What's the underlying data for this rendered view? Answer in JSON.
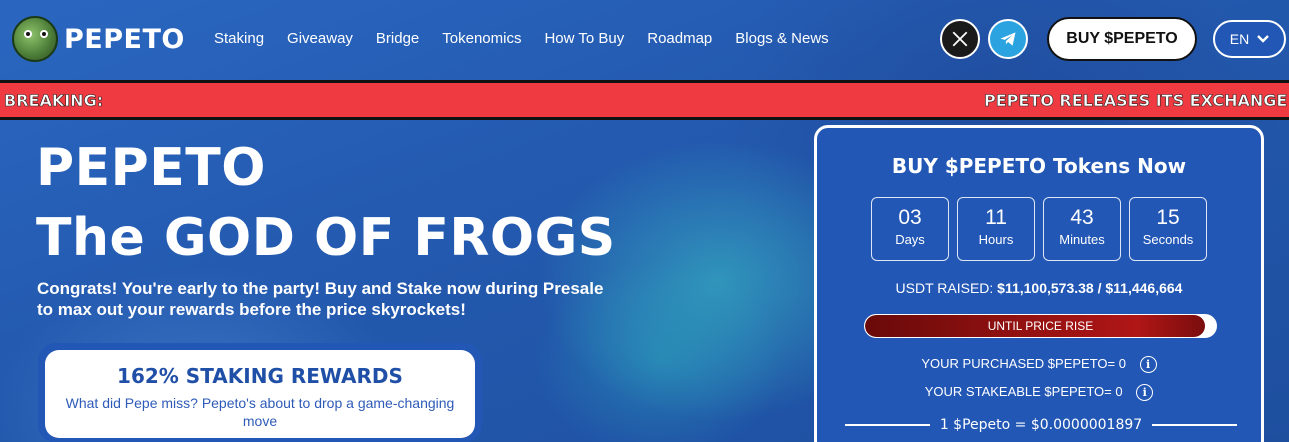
{
  "brand": {
    "name": "PEPETO"
  },
  "nav": {
    "items": [
      "Staking",
      "Giveaway",
      "Bridge",
      "Tokenomics",
      "How To Buy",
      "Roadmap",
      "Blogs & News"
    ]
  },
  "header": {
    "buy_label": "BUY $PEPETO",
    "lang_label": "EN",
    "social": [
      "x-icon",
      "telegram-icon"
    ]
  },
  "breaking": {
    "label": "BREAKING:",
    "text": "PEPETO RELEASES ITS EXCHANGE"
  },
  "hero": {
    "title_line1": "PEPETO",
    "title_line2": "The GOD OF FROGS",
    "description": "Congrats! You're early to the party! Buy and Stake now during Presale to max out your rewards before the price skyrockets!",
    "staking_title": "162% STAKING REWARDS",
    "staking_sub": "What did Pepe miss? Pepeto's about to drop a game-changing move"
  },
  "presale": {
    "title": "BUY $PEPETO Tokens Now",
    "timer": [
      {
        "value": "03",
        "label": "Days"
      },
      {
        "value": "11",
        "label": "Hours"
      },
      {
        "value": "43",
        "label": "Minutes"
      },
      {
        "value": "15",
        "label": "Seconds"
      }
    ],
    "raised_label": "USDT RAISED:",
    "raised_value": "$11,100,573.38 / $11,446,664",
    "progress_label": "UNTIL PRICE RISE",
    "progress_fraction": 0.97,
    "purchased": "YOUR PURCHASED $PEPETO= 0",
    "stakeable": "YOUR STAKEABLE $PEPETO= 0",
    "price": "1 $Pepeto = $0.0000001897"
  },
  "colors": {
    "accent_blue": "#2257b5",
    "breaking_red": "#ef3a41",
    "progress_red": "#b01616"
  }
}
